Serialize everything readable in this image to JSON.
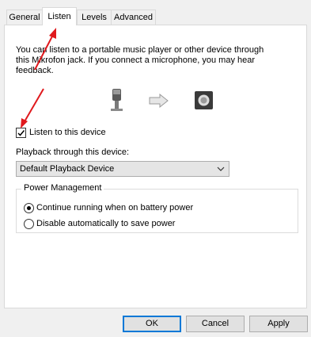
{
  "tabs": [
    {
      "label": "General"
    },
    {
      "label": "Listen"
    },
    {
      "label": "Levels"
    },
    {
      "label": "Advanced"
    }
  ],
  "description": "You can listen to a portable music player or other device through\nthis Mikrofon jack.  If you connect a microphone, you may hear\nfeedback.",
  "icons": {
    "source": "microphone-icon",
    "arrow": "right-arrow-icon",
    "target": "speaker-icon"
  },
  "listen_checkbox": {
    "label": "Listen to this device",
    "checked": true
  },
  "playback": {
    "label": "Playback through this device:",
    "selected": "Default Playback Device"
  },
  "power": {
    "title": "Power Management",
    "options": [
      {
        "label": "Continue running when on battery power",
        "selected": true
      },
      {
        "label": "Disable automatically to save power",
        "selected": false
      }
    ]
  },
  "buttons": {
    "ok": "OK",
    "cancel": "Cancel",
    "apply": "Apply"
  },
  "colors": {
    "annotation_red": "#e0191d",
    "accent": "#0078d7"
  }
}
